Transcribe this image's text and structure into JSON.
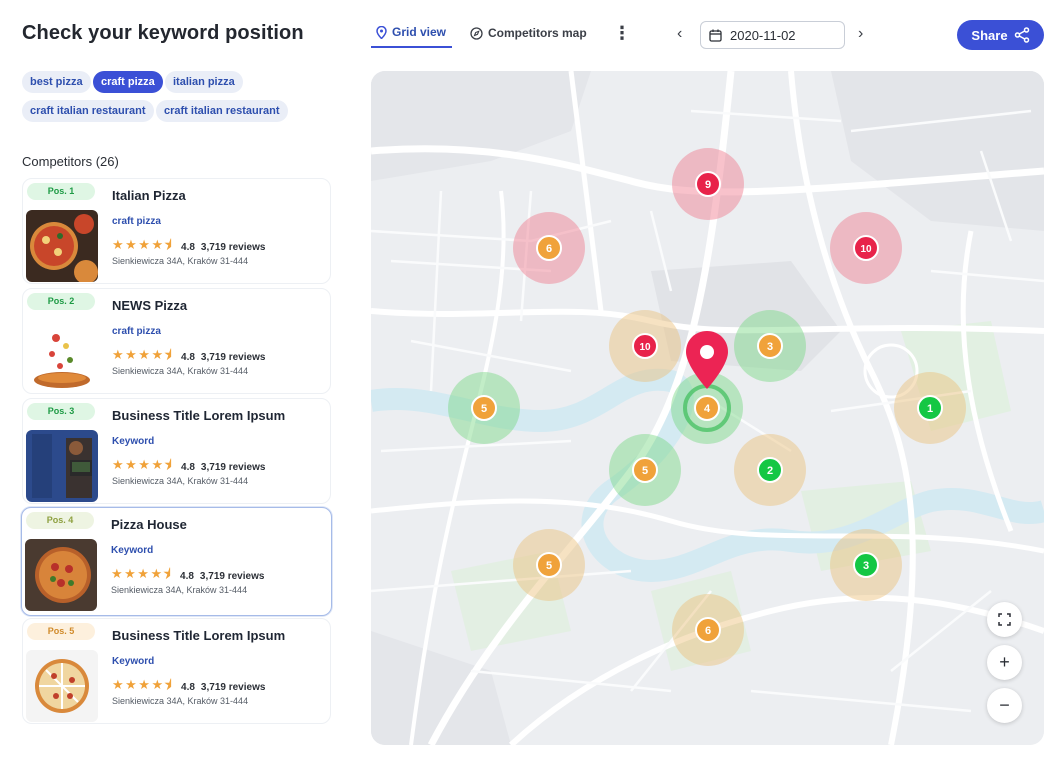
{
  "header": {
    "title": "Check your keyword position"
  },
  "keywords": [
    {
      "label": "best pizza",
      "active": false
    },
    {
      "label": "craft pizza",
      "active": true
    },
    {
      "label": "italian pizza",
      "active": false
    },
    {
      "label": "craft italian restaurant",
      "active": false
    },
    {
      "label": "craft italian restaurant",
      "active": false
    }
  ],
  "competitors": {
    "title": "Competitors (26)",
    "items": [
      {
        "pos": "Pos. 1",
        "name": "Italian Pizza",
        "keyword": "craft pizza",
        "rating": "4.8",
        "reviews": "3,719 reviews",
        "address": "Sienkiewicza 34A, Kraków 31-444",
        "stars": "★★★★⯨"
      },
      {
        "pos": "Pos. 2",
        "name": "NEWS Pizza",
        "keyword": "craft pizza",
        "rating": "4.8",
        "reviews": "3,719 reviews",
        "address": "Sienkiewicza 34A, Kraków 31-444",
        "stars": "★★★★⯨"
      },
      {
        "pos": "Pos. 3",
        "name": "Business Title Lorem Ipsum",
        "keyword": "Keyword",
        "rating": "4.8",
        "reviews": "3,719 reviews",
        "address": "Sienkiewicza 34A, Kraków 31-444",
        "stars": "★★★★⯨"
      },
      {
        "pos": "Pos. 4",
        "name": "Pizza House",
        "keyword": "Keyword",
        "rating": "4.8",
        "reviews": "3,719 reviews",
        "address": "Sienkiewicza 34A, Kraków 31-444",
        "stars": "★★★★⯨"
      },
      {
        "pos": "Pos. 5",
        "name": "Business Title Lorem Ipsum",
        "keyword": "Keyword",
        "rating": "4.8",
        "reviews": "3,719 reviews",
        "address": "Sienkiewicza 34A, Kraków 31-444",
        "stars": "★★★★⯨"
      }
    ]
  },
  "toolbar": {
    "grid_view": "Grid view",
    "competitors_map": "Competitors map",
    "date": "2020-11-02",
    "share": "Share"
  },
  "map": {
    "grid_points": [
      {
        "rank": "9",
        "level": "bad"
      },
      {
        "rank": "6",
        "level": "bad"
      },
      {
        "rank": "10",
        "level": "bad"
      },
      {
        "rank": "10",
        "level": "mid"
      },
      {
        "rank": "3",
        "level": "good"
      },
      {
        "rank": "5",
        "level": "good"
      },
      {
        "rank": "4",
        "level": "good"
      },
      {
        "rank": "1",
        "level": "mid"
      },
      {
        "rank": "5",
        "level": "good"
      },
      {
        "rank": "2",
        "level": "mid"
      },
      {
        "rank": "5",
        "level": "mid"
      },
      {
        "rank": "3",
        "level": "mid"
      },
      {
        "rank": "6",
        "level": "mid"
      }
    ]
  },
  "colors": {
    "accent": "#3b50d6",
    "rank_good": "#14c744",
    "rank_mid": "#f0a23a",
    "rank_bad": "#e8234a"
  }
}
